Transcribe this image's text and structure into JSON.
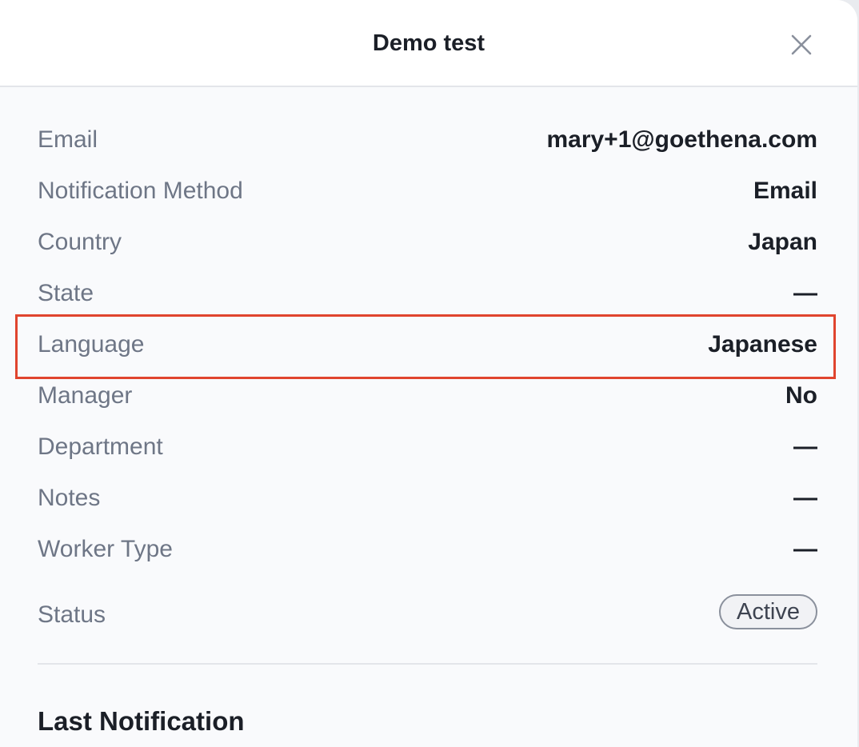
{
  "dialog": {
    "title": "Demo test",
    "close_icon": "close-icon"
  },
  "fields": [
    {
      "label": "Email",
      "value": "mary+1@goethena.com"
    },
    {
      "label": "Notification Method",
      "value": "Email"
    },
    {
      "label": "Country",
      "value": "Japan"
    },
    {
      "label": "State",
      "value": "—"
    },
    {
      "label": "Language",
      "value": "Japanese"
    },
    {
      "label": "Manager",
      "value": "No"
    },
    {
      "label": "Department",
      "value": "—"
    },
    {
      "label": "Notes",
      "value": "—"
    },
    {
      "label": "Worker Type",
      "value": "—"
    }
  ],
  "status": {
    "label": "Status",
    "value": "Active"
  },
  "last_notification": {
    "title": "Last Notification"
  },
  "colors": {
    "highlight": "#e0442e",
    "label_text": "#6e7686",
    "value_text": "#1b1f27",
    "panel_bg": "#f9fafc"
  }
}
